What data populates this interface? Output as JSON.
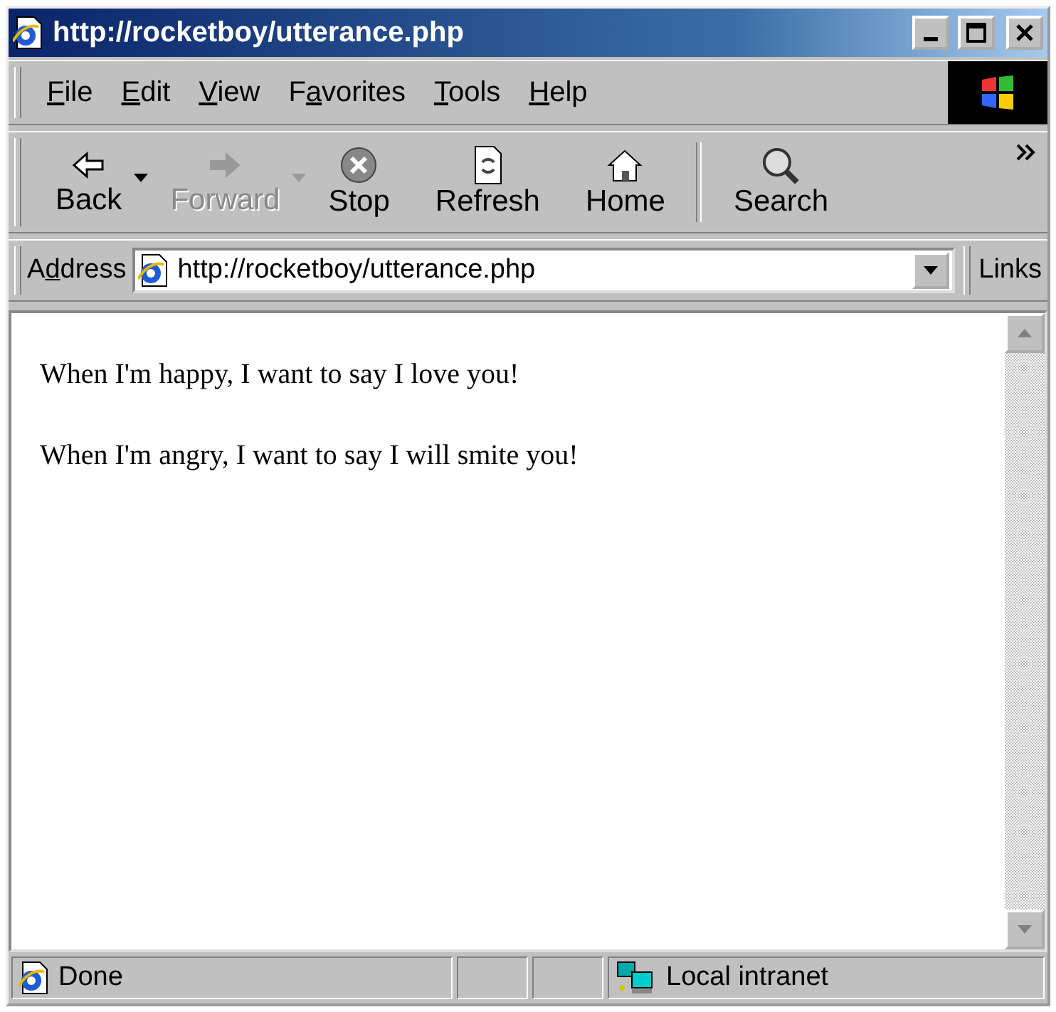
{
  "window": {
    "title": "http://rocketboy/utterance.php"
  },
  "menu": [
    {
      "access_key": "F",
      "after": "ile"
    },
    {
      "access_key": "E",
      "after": "dit"
    },
    {
      "access_key": "V",
      "after": "iew"
    },
    {
      "before": "F",
      "access_key": "a",
      "after": "vorites"
    },
    {
      "access_key": "T",
      "after": "ools"
    },
    {
      "access_key": "H",
      "after": "elp"
    }
  ],
  "toolbar": [
    {
      "kind": "back",
      "label": "Back",
      "disabled": false,
      "dropdown": true
    },
    {
      "kind": "forward",
      "label": "Forward",
      "disabled": true,
      "dropdown": true
    },
    {
      "kind": "stop",
      "label": "Stop",
      "disabled": false,
      "dropdown": false
    },
    {
      "kind": "refresh",
      "label": "Refresh",
      "disabled": false,
      "dropdown": false
    },
    {
      "kind": "home",
      "label": "Home",
      "disabled": false,
      "dropdown": false
    },
    {
      "kind": "separator"
    },
    {
      "kind": "search",
      "label": "Search",
      "disabled": false,
      "dropdown": false
    }
  ],
  "address_bar": {
    "before": "A",
    "access_key": "d",
    "after": "dress",
    "value": "http://rocketboy/utterance.php",
    "links": "Links"
  },
  "content": {
    "paragraphs": [
      "When I'm happy, I want to say I love you!",
      "When I'm angry, I want to say I will smite you!"
    ]
  },
  "status_bar": {
    "text": "Done",
    "zone": "Local intranet"
  }
}
